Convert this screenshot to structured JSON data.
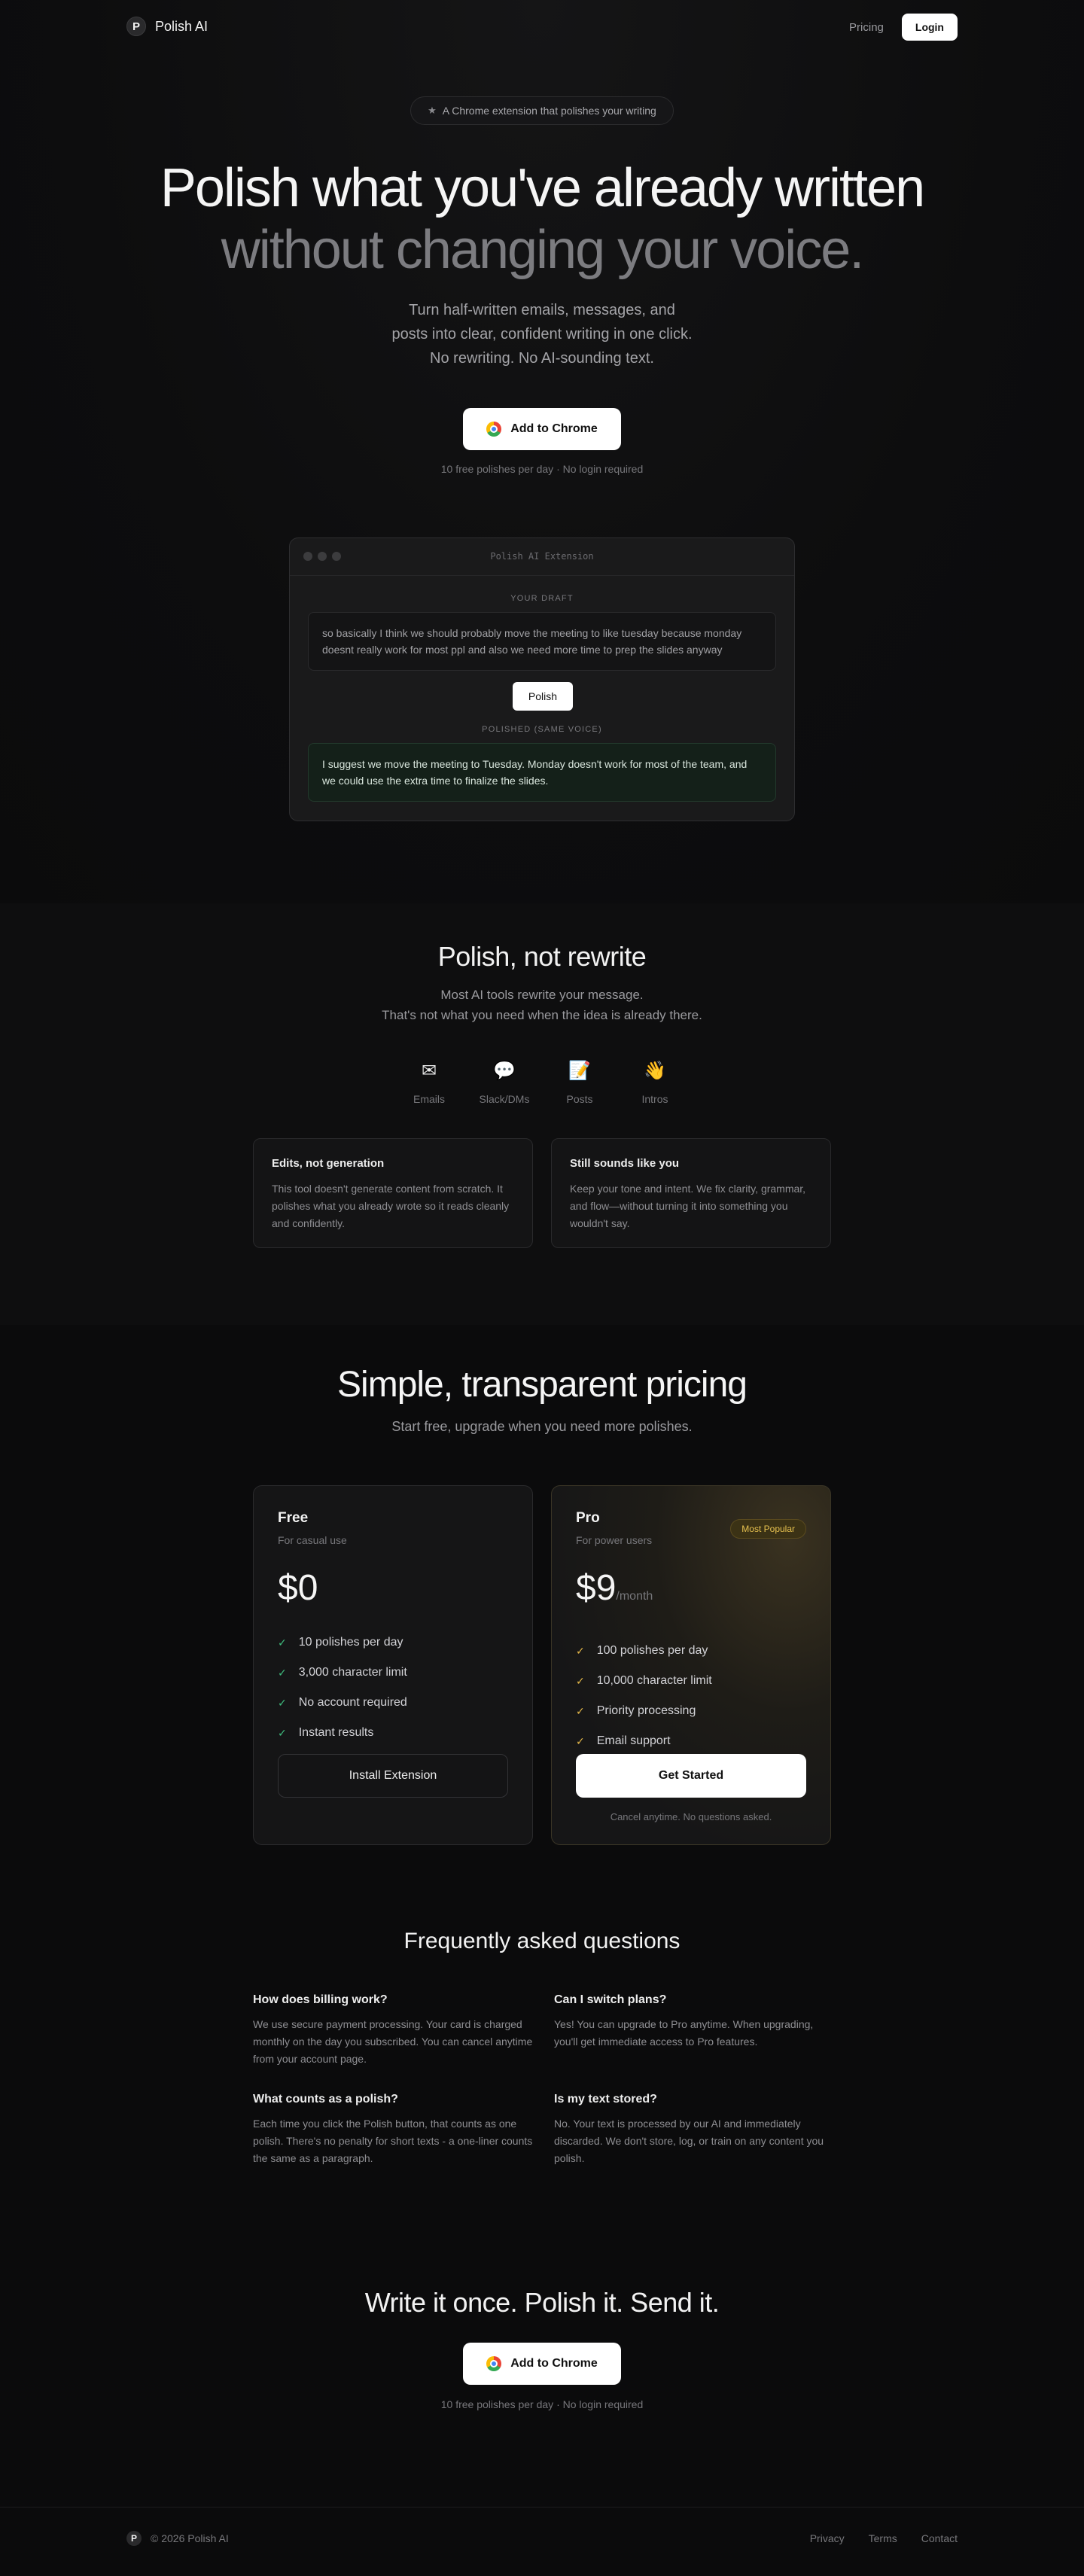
{
  "nav": {
    "logo_mark": "P",
    "brand": "Polish AI",
    "pricing_link": "Pricing",
    "login_button": "Login"
  },
  "hero": {
    "badge_icon": "star-icon",
    "badge_text": "A Chrome extension that polishes your writing",
    "title_line1": "Polish what you've already written",
    "title_line2": "without changing your voice.",
    "subtitle_line1": "Turn half-written emails, messages, and",
    "subtitle_line2": "posts into clear, confident writing in one click.",
    "subtitle_line3": "No rewriting. No AI-sounding text.",
    "cta_label": "Add to Chrome",
    "cta_note": "10 free polishes per day · No login required"
  },
  "demo": {
    "window_title": "Polish AI Extension",
    "draft_label": "YOUR DRAFT",
    "draft_text": "so basically I think we should probably move the meeting to like tuesday because monday doesnt really work for most ppl and also we need more time to prep the slides anyway",
    "polish_button": "Polish",
    "polished_label": "POLISHED (SAME VOICE)",
    "polished_text": "I suggest we move the meeting to Tuesday. Monday doesn't work for most of the team, and we could use the extra time to finalize the slides."
  },
  "polish_section": {
    "title": "Polish, not rewrite",
    "text_line1": "Most AI tools rewrite your message.",
    "text_line2": "That's not what you need when the idea is already there.",
    "categories": [
      {
        "icon": "envelope-icon",
        "glyph": "✉",
        "label": "Emails"
      },
      {
        "icon": "speech-bubble-icon",
        "glyph": "💬",
        "label": "Slack/DMs"
      },
      {
        "icon": "memo-icon",
        "glyph": "📝",
        "label": "Posts"
      },
      {
        "icon": "waving-hand-icon",
        "glyph": "👋",
        "label": "Intros"
      }
    ],
    "cards": [
      {
        "title": "Edits, not generation",
        "text": "This tool doesn't generate content from scratch. It polishes what you already wrote so it reads cleanly and confidently."
      },
      {
        "title": "Still sounds like you",
        "text": "Keep your tone and intent. We fix clarity, grammar, and flow—without turning it into something you wouldn't say."
      }
    ]
  },
  "pricing": {
    "title": "Simple, transparent pricing",
    "subtitle": "Start free, upgrade when you need more polishes.",
    "plans": [
      {
        "name": "Free",
        "for": "For casual use",
        "price": "$0",
        "period": "",
        "features": [
          "10 polishes per day",
          "3,000 character limit",
          "No account required",
          "Instant results"
        ],
        "button": "Install Extension",
        "note": ""
      },
      {
        "name": "Pro",
        "for": "For power users",
        "price": "$9",
        "period": "/month",
        "badge": "Most Popular",
        "features": [
          "100 polishes per day",
          "10,000 character limit",
          "Priority processing",
          "Email support"
        ],
        "button": "Get Started",
        "note": "Cancel anytime. No questions asked."
      }
    ],
    "check_glyph": "✓"
  },
  "faq": {
    "title": "Frequently asked questions",
    "items": [
      {
        "q": "How does billing work?",
        "a": "We use secure payment processing. Your card is charged monthly on the day you subscribed. You can cancel anytime from your account page."
      },
      {
        "q": "Can I switch plans?",
        "a": "Yes! You can upgrade to Pro anytime. When upgrading, you'll get immediate access to Pro features."
      },
      {
        "q": "What counts as a polish?",
        "a": "Each time you click the Polish button, that counts as one polish. There's no penalty for short texts - a one-liner counts the same as a paragraph."
      },
      {
        "q": "Is my text stored?",
        "a": "No. Your text is processed by our AI and immediately discarded. We don't store, log, or train on any content you polish."
      }
    ]
  },
  "final_cta": {
    "title": "Write it once. Polish it. Send it.",
    "button": "Add to Chrome",
    "note": "10 free polishes per day · No login required"
  },
  "footer": {
    "logo_mark": "P",
    "copyright": "© 2026 Polish AI",
    "links": [
      "Privacy",
      "Terms",
      "Contact"
    ]
  },
  "colors": {
    "background": "#0b0b0c",
    "free_check": "#3fbf7f",
    "pro_check": "#e6b94a",
    "pro_badge": "#e6c14f"
  }
}
